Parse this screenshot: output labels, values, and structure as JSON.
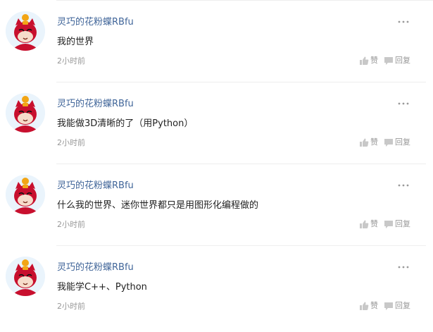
{
  "comments": [
    {
      "username": "灵巧的花粉蝶RBfu",
      "content": "我的世界",
      "time": "2小时前",
      "like_label": "赞",
      "reply_label": "回复"
    },
    {
      "username": "灵巧的花粉蝶RBfu",
      "content": "我能做3D清晰的了（用Python）",
      "time": "2小时前",
      "like_label": "赞",
      "reply_label": "回复"
    },
    {
      "username": "灵巧的花粉蝶RBfu",
      "content": "什么我的世界、迷你世界都只是用图形化编程做的",
      "time": "2小时前",
      "like_label": "赞",
      "reply_label": "回复"
    },
    {
      "username": "灵巧的花粉蝶RBfu",
      "content": "我能学C++、Python",
      "time": "2小时前",
      "like_label": "赞",
      "reply_label": "回复"
    }
  ],
  "colors": {
    "username": "#406599",
    "content": "#222222",
    "meta": "#999999",
    "avatar_red": "#c8102e",
    "avatar_background": "#eaf4fc"
  },
  "icons": {
    "more": "more-dots-icon",
    "like": "thumbs-up-icon",
    "reply": "reply-icon",
    "avatar": "cartoon-cat-avatar"
  }
}
